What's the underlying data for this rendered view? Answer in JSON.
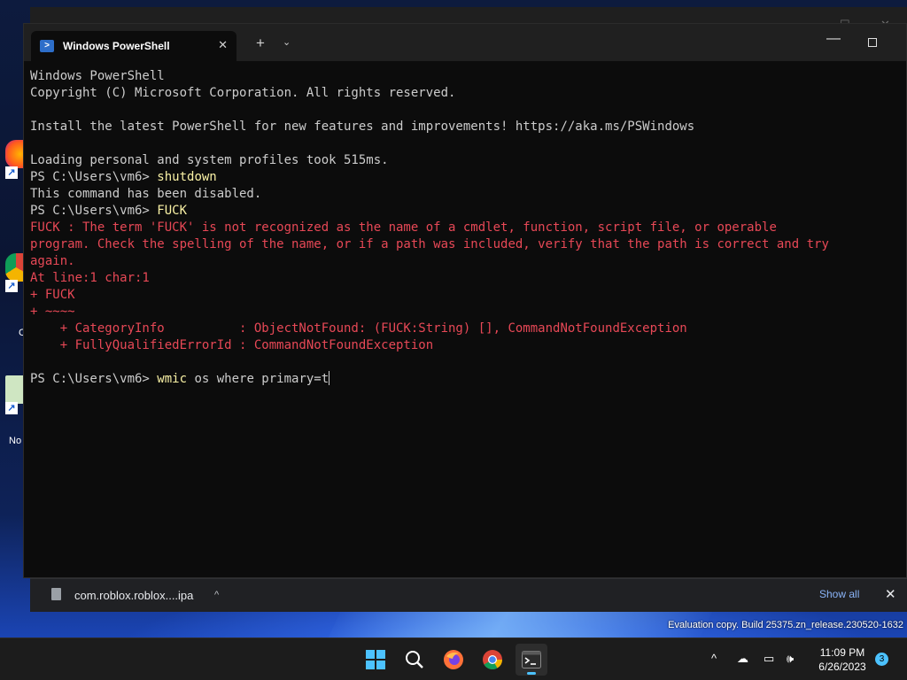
{
  "window": {
    "tab_title": "Windows PowerShell",
    "new_tab_glyph": "+",
    "dropdown_glyph": "⌄",
    "close_glyph": "✕",
    "minimize_glyph": "—"
  },
  "console": {
    "lines": [
      {
        "kind": "out",
        "text": "Windows PowerShell"
      },
      {
        "kind": "out",
        "text": "Copyright (C) Microsoft Corporation. All rights reserved."
      },
      {
        "kind": "out",
        "text": ""
      },
      {
        "kind": "out",
        "text": "Install the latest PowerShell for new features and improvements! https://aka.ms/PSWindows"
      },
      {
        "kind": "out",
        "text": ""
      },
      {
        "kind": "out",
        "text": "Loading personal and system profiles took 515ms."
      },
      {
        "kind": "prompt",
        "prompt": "PS C:\\Users\\vm6> ",
        "command": "shutdown"
      },
      {
        "kind": "out",
        "text": "This command has been disabled."
      },
      {
        "kind": "prompt",
        "prompt": "PS C:\\Users\\vm6> ",
        "command": "FUCK"
      },
      {
        "kind": "err",
        "text": "FUCK : The term 'FUCK' is not recognized as the name of a cmdlet, function, script file, or operable"
      },
      {
        "kind": "err",
        "text": "program. Check the spelling of the name, or if a path was included, verify that the path is correct and try"
      },
      {
        "kind": "err",
        "text": "again."
      },
      {
        "kind": "err",
        "text": "At line:1 char:1"
      },
      {
        "kind": "err",
        "text": "+ FUCK"
      },
      {
        "kind": "err",
        "text": "+ ~~~~"
      },
      {
        "kind": "err",
        "text": "    + CategoryInfo          : ObjectNotFound: (FUCK:String) [], CommandNotFoundException"
      },
      {
        "kind": "err",
        "text": "    + FullyQualifiedErrorId : CommandNotFoundException"
      },
      {
        "kind": "out",
        "text": ""
      },
      {
        "kind": "prompt-active",
        "prompt": "PS C:\\Users\\vm6> ",
        "command": "wmic",
        "args": " os where primary=t"
      }
    ]
  },
  "download_bar": {
    "file_name": "com.roblox.roblox....ipa",
    "show_all": "Show all",
    "close_glyph": "✕",
    "chevron_glyph": "^"
  },
  "watermark": "Evaluation copy. Build 25375.zn_release.230520-1632",
  "taskbar": {
    "apps": [
      {
        "name": "start-button",
        "icon": "windows-logo"
      },
      {
        "name": "search-button",
        "icon": "search-icon"
      },
      {
        "name": "firefox-button",
        "icon": "firefox-icon"
      },
      {
        "name": "chrome-button",
        "icon": "chrome-icon"
      },
      {
        "name": "terminal-button",
        "icon": "terminal-icon"
      }
    ],
    "time": "11:09 PM",
    "date": "6/26/2023",
    "notification_count": "3"
  },
  "desktop": {
    "icon_label_partial_1": "C",
    "icon_label_partial_2": "No"
  },
  "colors": {
    "console_bg": "#0c0c0c",
    "console_fg": "#cccccc",
    "command": "#f9f1a5",
    "error": "#e74856",
    "accent": "#4cc2ff"
  }
}
